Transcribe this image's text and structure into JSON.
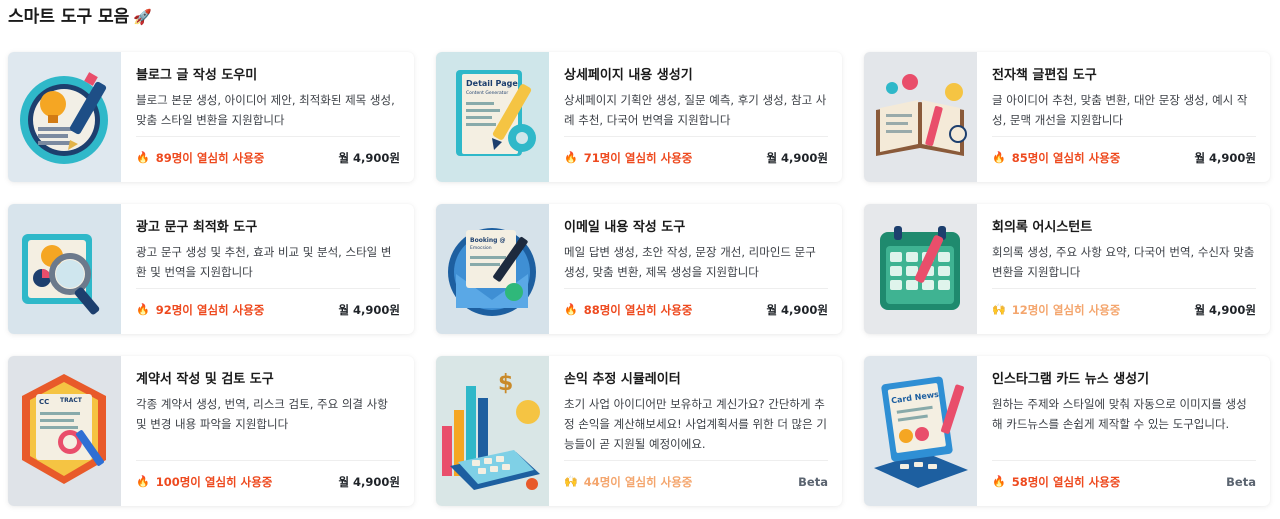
{
  "header": {
    "title": "스마트 도구 모음",
    "title_emoji": "🚀"
  },
  "tools": [
    {
      "title": "블로그 글 작성 도우미",
      "desc": "블로그 본문 생성, 아이디어 제안, 최적화된 제목 생성, 맞춤 스타일 변환을 지원합니다",
      "usage_icon": "🔥",
      "usage": "89명이 열심히 사용중",
      "price": "월 4,900원"
    },
    {
      "title": "상세페이지 내용 생성기",
      "desc": "상세페이지 기획안 생성, 질문 예측, 후기 생성, 참고 사례 추천, 다국어 번역을 지원합니다",
      "usage_icon": "🔥",
      "usage": "71명이 열심히 사용중",
      "price": "월 4,900원",
      "thumb_text": [
        "Detail Page",
        "Content Generator"
      ]
    },
    {
      "title": "전자책 글편집 도구",
      "desc": "글 아이디어 추천, 맞춤 변환, 대안 문장 생성, 예시 작성, 문맥 개선을 지원합니다",
      "usage_icon": "🔥",
      "usage": "85명이 열심히 사용중",
      "price": "월 4,900원"
    },
    {
      "title": "광고 문구 최적화 도구",
      "desc": "광고 문구 생성 및 추천, 효과 비교 및 분석, 스타일 변환 및 번역을 지원합니다",
      "usage_icon": "🔥",
      "usage": "92명이 열심히 사용중",
      "price": "월 4,900원"
    },
    {
      "title": "이메일 내용 작성 도구",
      "desc": "메일 답변 생성, 초안 작성, 문장 개선, 리마인드 문구 생성, 맞춤 변환, 제목 생성을 지원합니다",
      "usage_icon": "🔥",
      "usage": "88명이 열심히 사용중",
      "price": "월 4,900원",
      "thumb_text": [
        "Booking @",
        "Emocsion"
      ]
    },
    {
      "title": "회의록 어시스턴트",
      "desc": "회의록 생성, 주요 사항 요약, 다국어 번역, 수신자 맞춤 변환을 지원합니다",
      "usage_icon": "🙌",
      "usage": "12명이 열심히 사용중",
      "price": "월 4,900원",
      "muted": true
    },
    {
      "title": "계약서 작성 및 검토 도구",
      "desc": "각종 계약서 생성, 번역, 리스크 검토, 주요 의결 사항 및 변경 내용 파악을 지원합니다",
      "usage_icon": "🔥",
      "usage": "100명이 열심히 사용중",
      "price": "월 4,900원",
      "thumb_text": [
        "CC",
        "TRACT"
      ]
    },
    {
      "title": "손익 추정 시뮬레이터",
      "desc": "초기 사업 아이디어만 보유하고 계신가요? 간단하게 추정 손익을 계산해보세요! 사업계획서를 위한 더 많은 기능들이 곧 지원될 예정이에요.",
      "usage_icon": "🙌",
      "usage": "44명이 열심히 사용중",
      "price": "Beta",
      "muted": true,
      "beta": true
    },
    {
      "title": "인스타그램 카드 뉴스 생성기",
      "desc": "원하는 주제와 스타일에 맞춰 자동으로 이미지를 생성해 카드뉴스를 손쉽게 제작할 수 있는 도구입니다.",
      "usage_icon": "🔥",
      "usage": "58명이 열심히 사용중",
      "price": "Beta",
      "beta": true,
      "thumb_text": [
        "Card News"
      ]
    }
  ],
  "colors": {
    "usage_hot": "#ee4a1f",
    "usage_muted": "#f4a66e",
    "beta": "#5b6470"
  }
}
